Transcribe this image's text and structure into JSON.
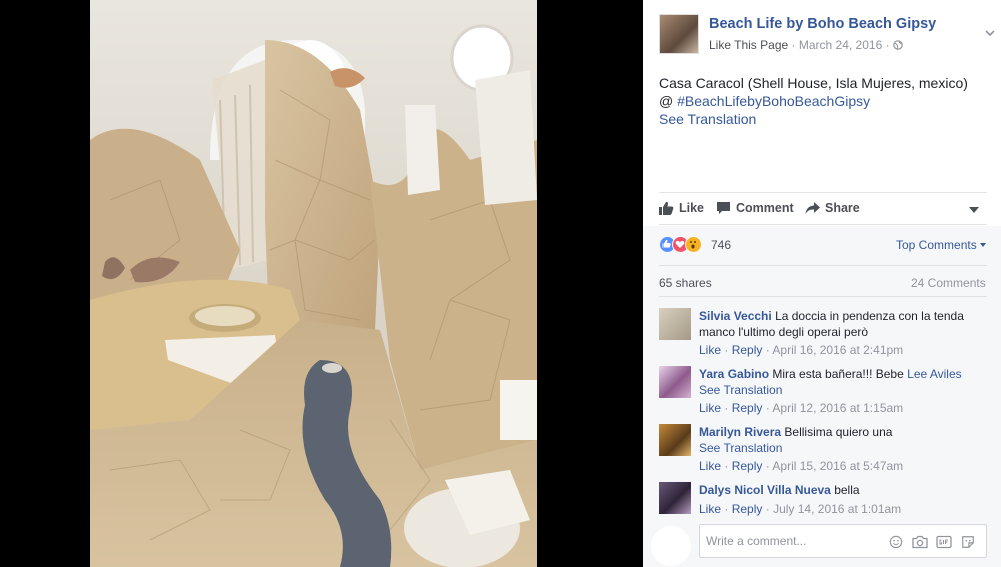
{
  "post": {
    "page_name": "Beach Life by Boho Beach Gipsy",
    "like_page": "Like This Page",
    "dot": "·",
    "date": "March 24, 2016",
    "text": "Casa Caracol (Shell House, Isla Mujeres, mexico)",
    "at": "@",
    "hashtag": "#BeachLifebyBohoBeachGipsy",
    "see_translation": "See Translation"
  },
  "actions": {
    "like": "Like",
    "comment": "Comment",
    "share": "Share"
  },
  "stats": {
    "reaction_count": "746",
    "reactions": [
      "like",
      "love",
      "wow"
    ],
    "top_comments": "Top Comments",
    "shares": "65 shares",
    "comments": "24 Comments"
  },
  "comments": [
    {
      "name": "Silvia Vecchi",
      "text": "La doccia in pendenza con la tenda manco l'ultimo degli operai però",
      "like": "Like",
      "reply": "Reply",
      "sep": "·",
      "date": "April 16, 2016 at 2:41pm"
    },
    {
      "name": "Yara Gabino",
      "text": "Mira esta bañera!!! Bebe",
      "mention": "Lee Aviles",
      "see_translation": "See Translation",
      "like": "Like",
      "reply": "Reply",
      "sep": "·",
      "date": "April 12, 2016 at 1:15am"
    },
    {
      "name": "Marilyn Rivera",
      "text": "Bellisima quiero una",
      "see_translation": "See Translation",
      "like": "Like",
      "reply": "Reply",
      "sep": "·",
      "date": "April 15, 2016 at 5:47am"
    },
    {
      "name": "Dalys Nicol Villa Nueva",
      "text": "bella",
      "like": "Like",
      "reply": "Reply",
      "sep": "·",
      "date": "July 14, 2016 at 1:01am"
    }
  ],
  "composer": {
    "placeholder": "Write a comment..."
  },
  "colors": {
    "link": "#365899",
    "like_reaction": "#5890ff",
    "love_reaction": "#f25268",
    "wow_reaction": "#f7b125"
  }
}
